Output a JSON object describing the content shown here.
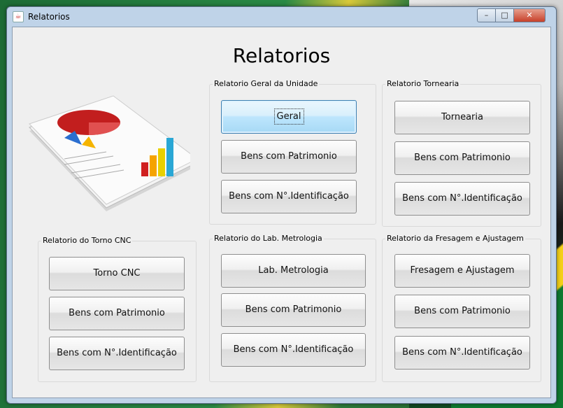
{
  "window": {
    "title": "Relatorios"
  },
  "main": {
    "heading": "Relatorios"
  },
  "panels": {
    "geral": {
      "title": "Relatorio Geral da Unidade",
      "buttons": [
        "Geral",
        "Bens com Patrimonio",
        "Bens com N°.Identificação"
      ]
    },
    "tornearia": {
      "title": "Relatorio Tornearia",
      "buttons": [
        "Tornearia",
        "Bens com Patrimonio",
        "Bens com N°.Identificação"
      ]
    },
    "torno_cnc": {
      "title": "Relatorio do Torno CNC",
      "buttons": [
        "Torno CNC",
        "Bens com Patrimonio",
        "Bens com N°.Identificação"
      ]
    },
    "metrologia": {
      "title": "Relatorio do Lab. Metrologia",
      "buttons": [
        "Lab. Metrologia",
        "Bens com Patrimonio",
        "Bens com N°.Identificação"
      ]
    },
    "fresagem": {
      "title": "Relatorio da Fresagem e Ajustagem",
      "buttons": [
        "Fresagem e Ajustagem",
        "Bens com Patrimonio",
        "Bens com N°.Identificação"
      ]
    }
  },
  "illustration": {
    "icon": "report-document-chart-icon"
  },
  "title_buttons": {
    "minimize": "–",
    "maximize": "□",
    "close": "✕"
  },
  "colors": {
    "focused_button": "#bee6fd",
    "window_frame": "#bfd3e8"
  }
}
